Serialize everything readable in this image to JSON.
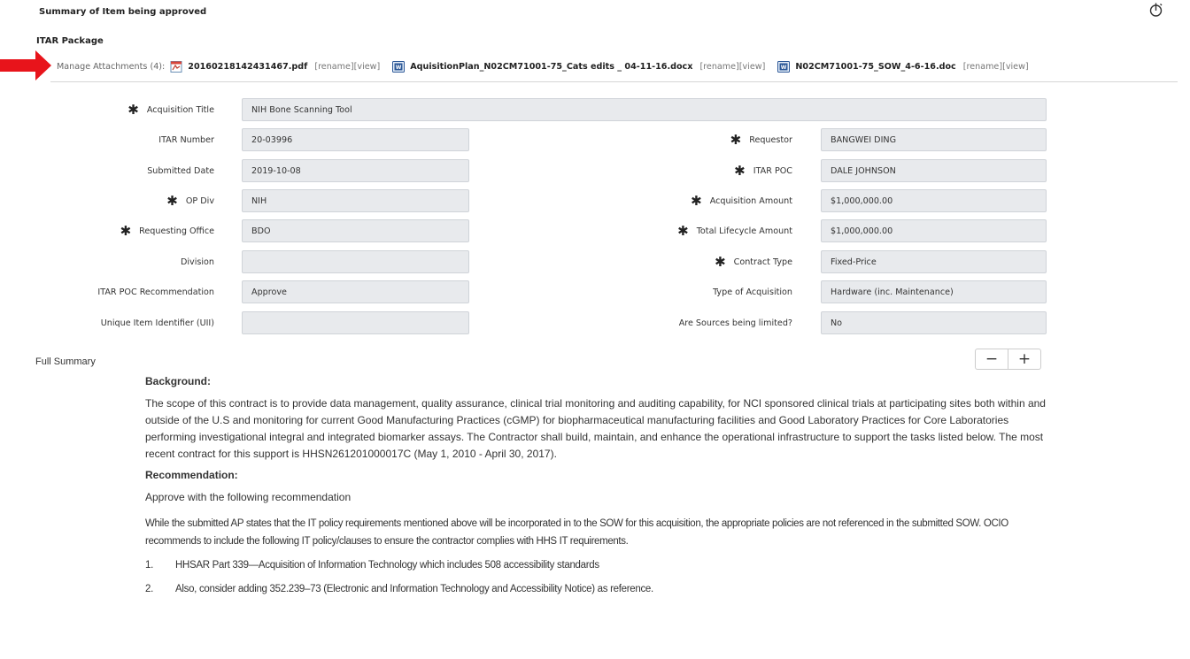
{
  "header": {
    "title": "Summary of Item being approved",
    "timer_icon": "timer-icon"
  },
  "package": {
    "title": "ITAR Package",
    "attachments_label": "Manage Attachments (4):",
    "rename_label": "[rename]",
    "view_label": "[view]",
    "files": [
      {
        "name": "20160218142431467.pdf",
        "icon": "pdf-file-icon"
      },
      {
        "name": "AquisitionPlan_N02CM71001-75_Cats edits _ 04-11-16.docx",
        "icon": "word-file-icon"
      },
      {
        "name": "N02CM71001-75_SOW_4-6-16.doc",
        "icon": "word-file-icon"
      }
    ],
    "annotation_color": "#e8141b"
  },
  "form": {
    "acquisition_title": {
      "label": "Acquisition Title",
      "value": "NIH Bone Scanning Tool",
      "required": true
    },
    "left": [
      {
        "label": "ITAR Number",
        "value": "20-03996",
        "required": false
      },
      {
        "label": "Submitted Date",
        "value": "2019-10-08",
        "required": false
      },
      {
        "label": "OP Div",
        "value": "NIH",
        "required": true
      },
      {
        "label": "Requesting Office",
        "value": "BDO",
        "required": true
      },
      {
        "label": "Division",
        "value": "",
        "required": false
      },
      {
        "label": "ITAR POC Recommendation",
        "value": "Approve",
        "required": false
      },
      {
        "label": "Unique Item Identifier (UII)",
        "value": "",
        "required": false
      }
    ],
    "right": [
      {
        "label": "Requestor",
        "value": "BANGWEI DING",
        "required": true
      },
      {
        "label": "ITAR POC",
        "value": "DALE JOHNSON",
        "required": true
      },
      {
        "label": "Acquisition Amount",
        "value": "$1,000,000.00",
        "required": true
      },
      {
        "label": "Total Lifecycle Amount",
        "value": "$1,000,000.00",
        "required": true
      },
      {
        "label": "Contract Type",
        "value": "Fixed-Price",
        "required": true
      },
      {
        "label": "Type of Acquisition",
        "value": "Hardware (inc. Maintenance)",
        "required": false
      },
      {
        "label": "Are Sources being limited?",
        "value": "No",
        "required": false
      }
    ],
    "required_marker": "✱"
  },
  "summary": {
    "label": "Full Summary",
    "zoom_out": "−",
    "zoom_in": "+",
    "background_heading": "Background:",
    "background_text": "The scope of this contract is to provide data management, quality assurance, clinical trial monitoring and auditing capability, for NCI sponsored clinical trials at participating sites both within and outside of the U.S and monitoring for current Good Manufacturing Practices (cGMP) for biopharmaceutical manufacturing facilities and Good Laboratory Practices for Core Laboratories performing investigational integral and integrated biomarker assays.  The Contractor shall build, maintain, and enhance the operational infrastructure to support the tasks listed below.  The most recent contract for this support is HHSN261201000017C (May 1, 2010 - April 30, 2017).",
    "recommendation_heading": "Recommendation:",
    "recommendation_intro": "Approve with the following recommendation",
    "recommendation_text": "While the submitted AP states that the IT policy requirements mentioned above will be incorporated in to the SOW for this acquisition, the appropriate policies are not referenced in the submitted SOW.  OCIO recommends to include the following IT policy/clauses to ensure the contractor complies with HHS IT requirements.",
    "items": [
      {
        "num": "1.",
        "text": "HHSAR Part 339—Acquisition of Information Technology which includes 508 accessibility standards"
      },
      {
        "num": "2.",
        "text": "Also, consider adding 352.239–73 (Electronic and Information Technology and Accessibility Notice) as reference."
      }
    ]
  }
}
